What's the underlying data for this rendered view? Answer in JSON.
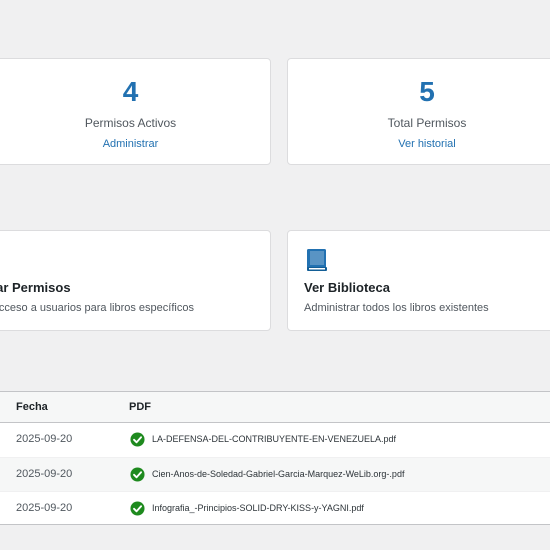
{
  "stats": [
    {
      "number": "4",
      "label": "Permisos Activos",
      "link": "Administrar"
    },
    {
      "number": "5",
      "label": "Total Permisos",
      "link": "Ver historial"
    }
  ],
  "actions": [
    {
      "title": "Asignar Permisos",
      "description": "Dar acceso a usuarios para libros específicos",
      "icon": "key-icon"
    },
    {
      "title": "Ver Biblioteca",
      "description": "Administrar todos los libros existentes",
      "icon": "book-icon"
    }
  ],
  "table": {
    "headers": {
      "fecha": "Fecha",
      "pdf": "PDF"
    },
    "rows": [
      {
        "fecha": "2025-09-20",
        "pdf": "LA-DEFENSA-DEL-CONTRIBUYENTE-EN-VENEZUELA.pdf",
        "status_icon": "check-icon"
      },
      {
        "fecha": "2025-09-20",
        "pdf": "Cien-Anos-de-Soledad-Gabriel-Garcia-Marquez-WeLib.org-.pdf",
        "status_icon": "check-icon"
      },
      {
        "fecha": "2025-09-20",
        "pdf": "Infografia_-Principios-SOLID-DRY-KISS-y-YAGNI.pdf",
        "status_icon": "check-icon"
      }
    ]
  },
  "colors": {
    "accent": "#2271b1",
    "success": "#1e8a1e",
    "background": "#f0f0f1"
  }
}
